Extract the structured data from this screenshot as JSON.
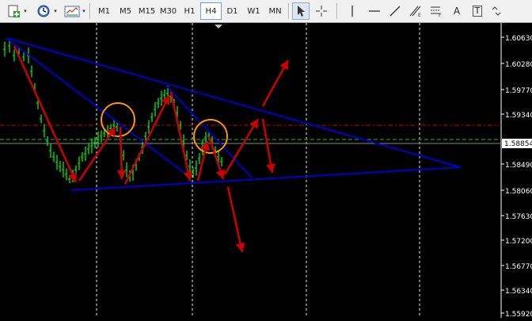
{
  "toolbar": {
    "timeframes": [
      "M1",
      "M5",
      "M15",
      "M30",
      "H1",
      "H4",
      "D1",
      "W1",
      "MN"
    ],
    "active_timeframe": "H4",
    "text_tool_label": "A",
    "text_label_tool_label": "T"
  },
  "price_axis": {
    "labels": [
      "1.60630",
      "1.60280",
      "1.59770",
      "1.59340",
      "1.58490",
      "1.58060",
      "1.57630",
      "1.57200",
      "1.56770",
      "1.56340",
      "1.55920"
    ],
    "current_price": "1.58854"
  },
  "colors": {
    "background": "#000000",
    "candle": "#00ff00",
    "trendline": "#0000cc",
    "arrow": "#cc0000",
    "circle": "#ff9900",
    "red_dash_level": "#cc0000",
    "green_dash_level": "#00cc00",
    "grid": "#ffffff"
  }
}
